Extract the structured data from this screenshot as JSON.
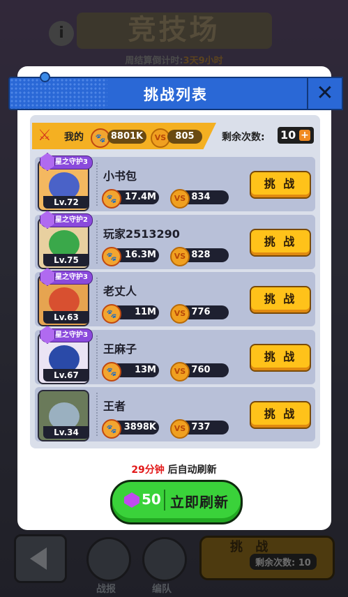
{
  "background": {
    "title": "竞技场",
    "timer_label": "周结算倒计时:",
    "timer_value": "3天9小时",
    "info_icon": "info-icon"
  },
  "bottom_nav": {
    "battle_report": "战报",
    "formation": "编队",
    "challenge": "挑 战",
    "remaining": "剩余次数: 10"
  },
  "dialog": {
    "title": "挑战列表",
    "close_icon": "close-icon"
  },
  "me": {
    "label": "我的",
    "power": "8801K",
    "score": "805",
    "remaining_label": "剩余次数:",
    "remaining_count": "10"
  },
  "opponents": [
    {
      "name": "小书包",
      "level": "Lv.72",
      "guard": "星之守护3",
      "power": "17.4M",
      "score": "834",
      "button": "挑 战",
      "face_color": "#4a62c8",
      "bg_color": "#f4b860"
    },
    {
      "name": "玩家2513290",
      "level": "Lv.75",
      "guard": "星之守护2",
      "power": "16.3M",
      "score": "828",
      "button": "挑 战",
      "face_color": "#3aa84a",
      "bg_color": "#e8d0a0"
    },
    {
      "name": "老丈人",
      "level": "Lv.63",
      "guard": "星之守护3",
      "power": "11M",
      "score": "776",
      "button": "挑 战",
      "face_color": "#d85030",
      "bg_color": "#e6a450"
    },
    {
      "name": "王麻子",
      "level": "Lv.67",
      "guard": "星之守护3",
      "power": "13M",
      "score": "760",
      "button": "挑 战",
      "face_color": "#2a4aa8",
      "bg_color": "#eae4f4"
    },
    {
      "name": "王者",
      "level": "Lv.34",
      "guard": "",
      "power": "3898K",
      "score": "737",
      "button": "挑 战",
      "face_color": "#9ab0c0",
      "bg_color": "#6a7a5a"
    }
  ],
  "refresh": {
    "minutes": "29分钟",
    "note": " 后自动刷新",
    "cost": "50",
    "label": "立即刷新"
  },
  "icons": {
    "paw": "paw-icon",
    "vs_coin": "vs-coin-icon",
    "gem": "gem-icon",
    "swords": "crossed-swords-icon",
    "plus": "plus-icon"
  }
}
